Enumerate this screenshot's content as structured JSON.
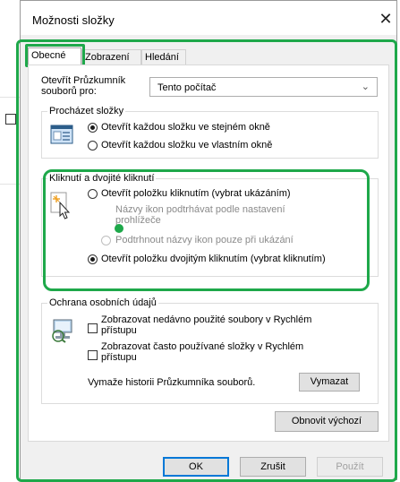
{
  "window": {
    "title": "Možnosti složky",
    "close_glyph": "✕"
  },
  "tabs": [
    {
      "label": "Obecné",
      "active": true
    },
    {
      "label": "Zobrazení",
      "active": false
    },
    {
      "label": "Hledání",
      "active": false
    }
  ],
  "open_explorer": {
    "label": "Otevřít Průzkumník souborů pro:",
    "value": "Tento počítač"
  },
  "browse_folders": {
    "legend": "Procházet složky",
    "options": [
      {
        "label": "Otevřít každou složku ve stejném okně",
        "checked": true
      },
      {
        "label": "Otevřít každou složku ve vlastním okně",
        "checked": false
      }
    ]
  },
  "click_settings": {
    "legend": "Kliknutí a dvojité kliknutí",
    "single_click": {
      "label": "Otevřít položku kliknutím (vybrat ukázáním)",
      "checked": false
    },
    "underline_browser": {
      "label": "Názvy ikon podtrhávat podle nastavení prohlížeče",
      "enabled": false
    },
    "underline_hover": {
      "label": "Podtrhnout názvy ikon pouze při ukázání",
      "enabled": false
    },
    "double_click": {
      "label": "Otevřít položku dvojitým kliknutím (vybrat kliknutím)",
      "checked": true
    }
  },
  "privacy": {
    "legend": "Ochrana osobních údajů",
    "recent_files": {
      "label": "Zobrazovat nedávno použité soubory v Rychlém přístupu",
      "checked": false
    },
    "frequent_folders": {
      "label": "Zobrazovat často používané složky v Rychlém přístupu",
      "checked": false
    },
    "clear_text": "Vymaže historii Průzkumníka souborů.",
    "clear_button": "Vymazat"
  },
  "restore_defaults": "Obnovit výchozí",
  "footer": {
    "ok": "OK",
    "cancel": "Zrušit",
    "apply": "Použít"
  },
  "colors": {
    "highlight": "#1ea84a",
    "accent": "#0078d7"
  }
}
